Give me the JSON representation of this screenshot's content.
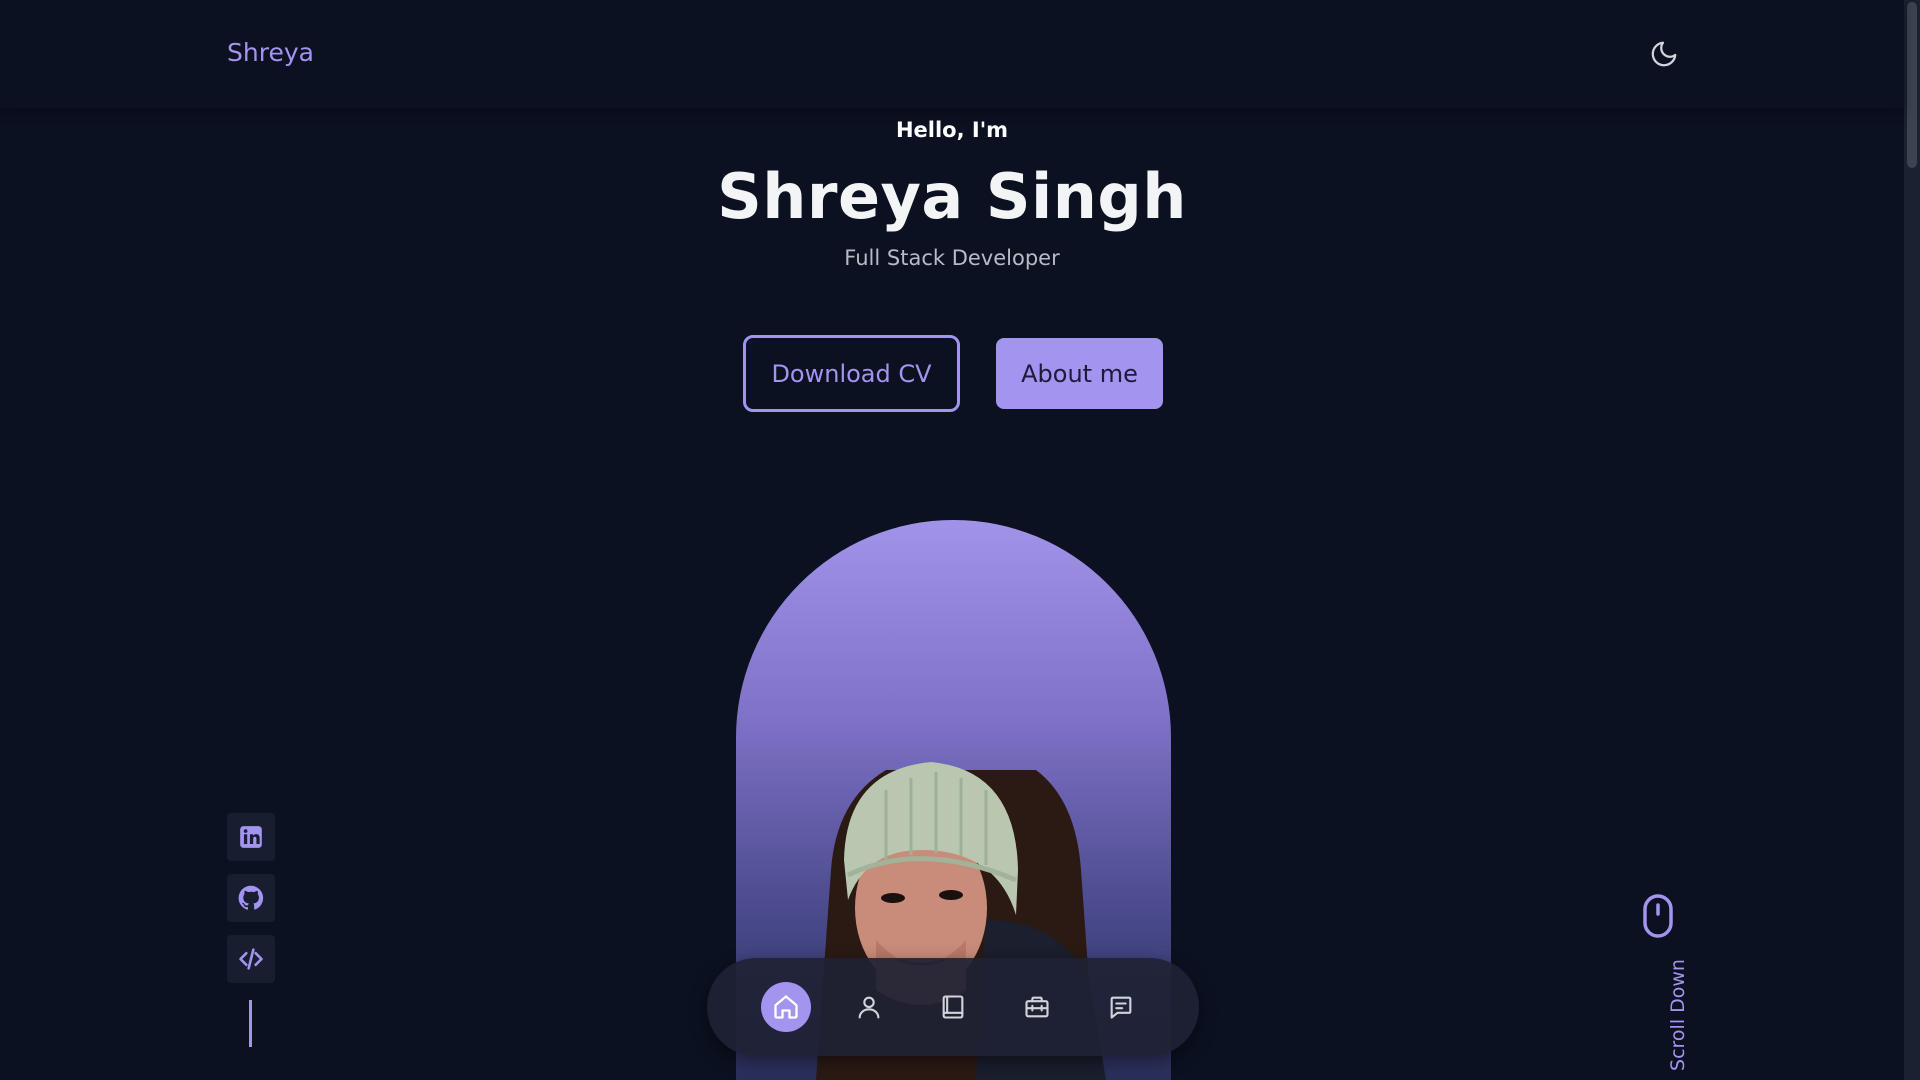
{
  "header": {
    "logo_text": "Shreya",
    "theme_icon": "moon-icon"
  },
  "hero": {
    "greeting": "Hello, I'm",
    "name": "Shreya Singh",
    "role": "Full Stack Developer",
    "download_cv_label": "Download CV",
    "about_me_label": "About me"
  },
  "social": {
    "items": [
      {
        "icon": "linkedin-icon"
      },
      {
        "icon": "github-icon"
      },
      {
        "icon": "code-icon"
      }
    ]
  },
  "scroll_down": {
    "label": "Scroll Down",
    "icon": "mouse-icon"
  },
  "bottom_nav": {
    "items": [
      {
        "icon": "home-icon",
        "active": true
      },
      {
        "icon": "user-icon",
        "active": false
      },
      {
        "icon": "book-icon",
        "active": false
      },
      {
        "icon": "briefcase-icon",
        "active": false
      },
      {
        "icon": "message-icon",
        "active": false
      }
    ]
  },
  "colors": {
    "background": "#0b1120",
    "accent": "#a394ef",
    "header_text": "#f3f4f6",
    "muted_text": "#b7bbc6"
  }
}
